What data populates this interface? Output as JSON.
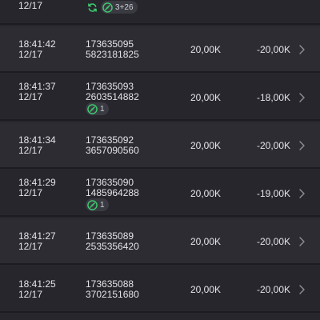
{
  "colors": {
    "background": "#26262c",
    "row_alt": "#2c2c32",
    "divider": "#1c1c21",
    "text": "#e4e4e8",
    "badge_green": "#3ecf6e"
  },
  "rows": [
    {
      "time": "",
      "date": "12/17",
      "id_top": "",
      "id_bottom": "",
      "amount": "",
      "result": "",
      "badges": [
        {
          "icon": "refresh-icon",
          "text": ""
        },
        {
          "icon": "stopwatch-icon",
          "text": "3+26"
        }
      ]
    },
    {
      "time": "18:41:42",
      "date": "12/17",
      "id_top": "173635095",
      "id_bottom": "5823181825",
      "amount": "20,00K",
      "result": "-20,00K",
      "badges": []
    },
    {
      "time": "18:41:37",
      "date": "12/17",
      "id_top": "173635093",
      "id_bottom": "2603514882",
      "amount": "20,00K",
      "result": "-18,00K",
      "badges": [
        {
          "icon": "stopwatch-icon",
          "text": "1"
        }
      ]
    },
    {
      "time": "18:41:34",
      "date": "12/17",
      "id_top": "173635092",
      "id_bottom": "3657090560",
      "amount": "20,00K",
      "result": "-20,00K",
      "badges": []
    },
    {
      "time": "18:41:29",
      "date": "12/17",
      "id_top": "173635090",
      "id_bottom": "1485964288",
      "amount": "20,00K",
      "result": "-19,00K",
      "badges": [
        {
          "icon": "stopwatch-icon",
          "text": "1"
        }
      ]
    },
    {
      "time": "18:41:27",
      "date": "12/17",
      "id_top": "173635089",
      "id_bottom": "2535356420",
      "amount": "20,00K",
      "result": "-20,00K",
      "badges": []
    },
    {
      "time": "18:41:25",
      "date": "12/17",
      "id_top": "173635088",
      "id_bottom": "3702151680",
      "amount": "20,00K",
      "result": "-20,00K",
      "badges": []
    }
  ]
}
